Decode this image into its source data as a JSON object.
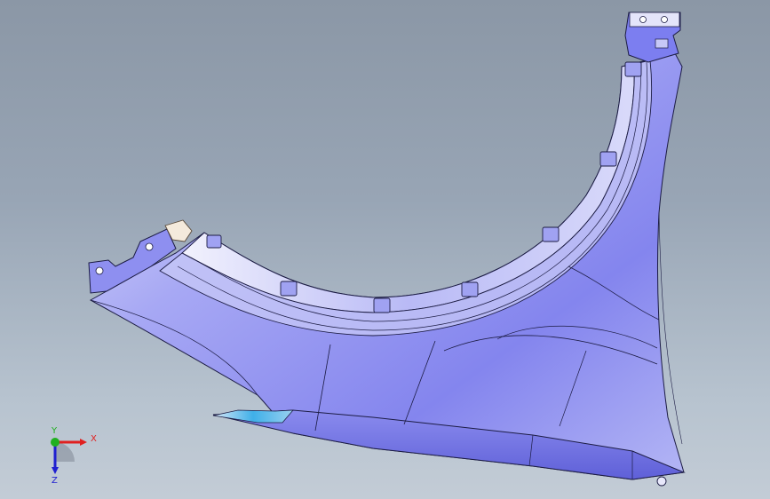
{
  "viewport": {
    "background_top": "#8b97a6",
    "background_bottom": "#c3ccd6",
    "model_color": "#7f7ff0",
    "edge_color": "#1c1c44"
  },
  "triad": {
    "x_label": "X",
    "y_label": "Y",
    "z_label": "Z",
    "x_color": "#e02020",
    "y_color": "#20b020",
    "z_color": "#2020d0"
  }
}
